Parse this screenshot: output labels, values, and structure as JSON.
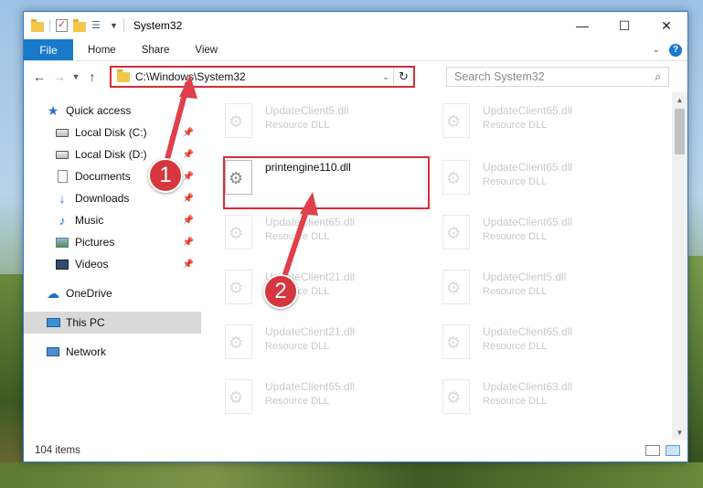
{
  "window": {
    "title": "System32",
    "controls": {
      "minimize": "—",
      "maximize": "☐",
      "close": "✕"
    }
  },
  "ribbon": {
    "file": "File",
    "tabs": [
      "Home",
      "Share",
      "View"
    ],
    "help": "?"
  },
  "nav": {
    "address": "C:\\Windows\\System32",
    "search_placeholder": "Search System32"
  },
  "sidebar": {
    "items": [
      {
        "label": "Quick access",
        "icon": "star-icon"
      },
      {
        "label": "Local Disk (C:)",
        "icon": "disk-icon"
      },
      {
        "label": "Local Disk (D:)",
        "icon": "disk-icon"
      },
      {
        "label": "Documents",
        "icon": "documents-icon"
      },
      {
        "label": "Downloads",
        "icon": "download-icon"
      },
      {
        "label": "Music",
        "icon": "music-icon"
      },
      {
        "label": "Pictures",
        "icon": "pictures-icon"
      },
      {
        "label": "Videos",
        "icon": "videos-icon"
      },
      {
        "label": "OneDrive",
        "icon": "cloud-icon"
      },
      {
        "label": "This PC",
        "icon": "computer-icon"
      },
      {
        "label": "Network",
        "icon": "network-icon"
      }
    ]
  },
  "files": [
    {
      "name": "UpdateClient5.dll",
      "type": "Resource DLL"
    },
    {
      "name": "UpdateClient65.dll",
      "type": "Resource DLL"
    },
    {
      "name": "printengine110.dll",
      "type": ""
    },
    {
      "name": "UpdateClient65.dll",
      "type": "Resource DLL"
    },
    {
      "name": "UpdateClient65.dll",
      "type": "Resource DLL"
    },
    {
      "name": "UpdateClient65.dll",
      "type": "Resource DLL"
    },
    {
      "name": "UpdateClient21.dll",
      "type": "Resource DLL"
    },
    {
      "name": "UpdateClient5.dll",
      "type": "Resource DLL"
    },
    {
      "name": "UpdateClient21.dll",
      "type": "Resource DLL"
    },
    {
      "name": "UpdateClient65.dll",
      "type": "Resource DLL"
    },
    {
      "name": "UpdateClient65.dll",
      "type": "Resource DLL"
    },
    {
      "name": "UpdateClient63.dll",
      "type": "Resource DLL"
    }
  ],
  "status": {
    "count": "104 items"
  },
  "annotations": {
    "step1": "1",
    "step2": "2"
  },
  "colors": {
    "accent": "#1979ca",
    "highlight": "#d62d36",
    "selected": "#d9d9d9"
  }
}
